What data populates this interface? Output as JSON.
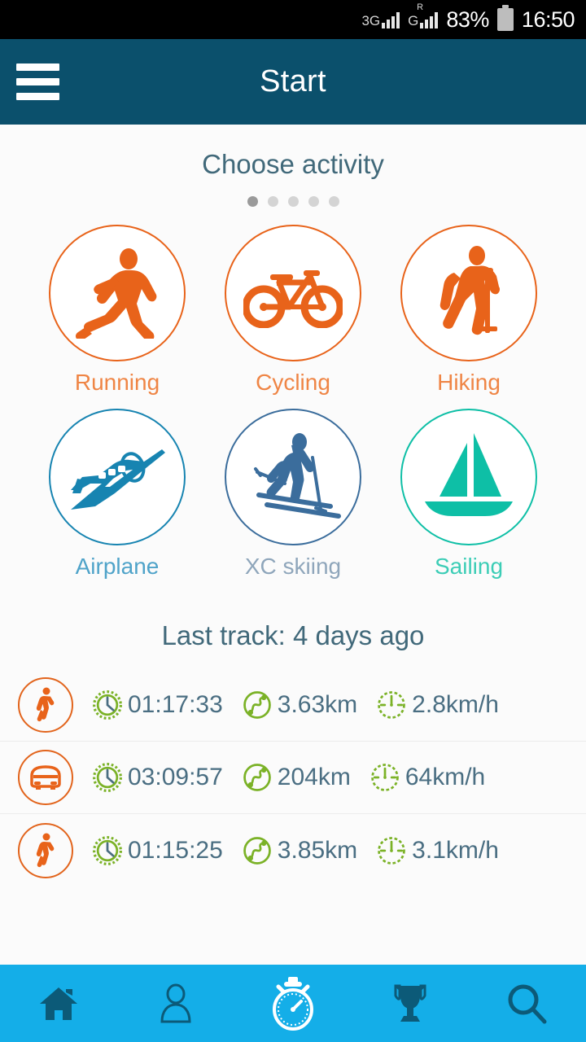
{
  "statusbar": {
    "network_primary": "3G",
    "network_secondary": "G",
    "roaming_indicator": "R",
    "battery_percent": "83%",
    "time": "16:50"
  },
  "appbar": {
    "title": "Start",
    "menu_icon": "hamburger-menu-icon"
  },
  "activity_section": {
    "title": "Choose activity",
    "pager": {
      "total": 5,
      "active_index": 0
    },
    "activities": [
      {
        "label": "Running",
        "icon": "running-icon",
        "color": "#e8631a",
        "label_color": "#ef8545"
      },
      {
        "label": "Cycling",
        "icon": "bicycle-icon",
        "color": "#e8631a",
        "label_color": "#ef8545"
      },
      {
        "label": "Hiking",
        "icon": "hiking-icon",
        "color": "#e8631a",
        "label_color": "#ef8545"
      },
      {
        "label": "Airplane",
        "icon": "airplane-icon",
        "color": "#1784b1",
        "label_color": "#4fa3c9"
      },
      {
        "label": "XC skiing",
        "icon": "skiing-icon",
        "color": "#3b6d9c",
        "label_color": "#8fa6bb"
      },
      {
        "label": "Sailing",
        "icon": "sailboat-icon",
        "color": "#0ebfa6",
        "label_color": "#3ccdb6"
      }
    ]
  },
  "last_track": {
    "title": "Last track: 4 days ago",
    "stat_icons": {
      "duration": "clock-icon",
      "distance": "route-icon",
      "speed": "speedometer-icon"
    },
    "rows": [
      {
        "activity_icon": "walking-icon",
        "duration": "01:17:33",
        "distance": "3.63km",
        "speed": "2.8km/h"
      },
      {
        "activity_icon": "car-icon",
        "duration": "03:09:57",
        "distance": "204km",
        "speed": "64km/h"
      },
      {
        "activity_icon": "walking-icon",
        "duration": "01:15:25",
        "distance": "3.85km",
        "speed": "3.1km/h"
      }
    ]
  },
  "bottom_nav": {
    "background": "#14aee8",
    "items": [
      {
        "name": "home-icon",
        "active": false
      },
      {
        "name": "profile-icon",
        "active": false
      },
      {
        "name": "stopwatch-icon",
        "active": true
      },
      {
        "name": "trophy-icon",
        "active": false
      },
      {
        "name": "search-icon",
        "active": false
      }
    ]
  }
}
